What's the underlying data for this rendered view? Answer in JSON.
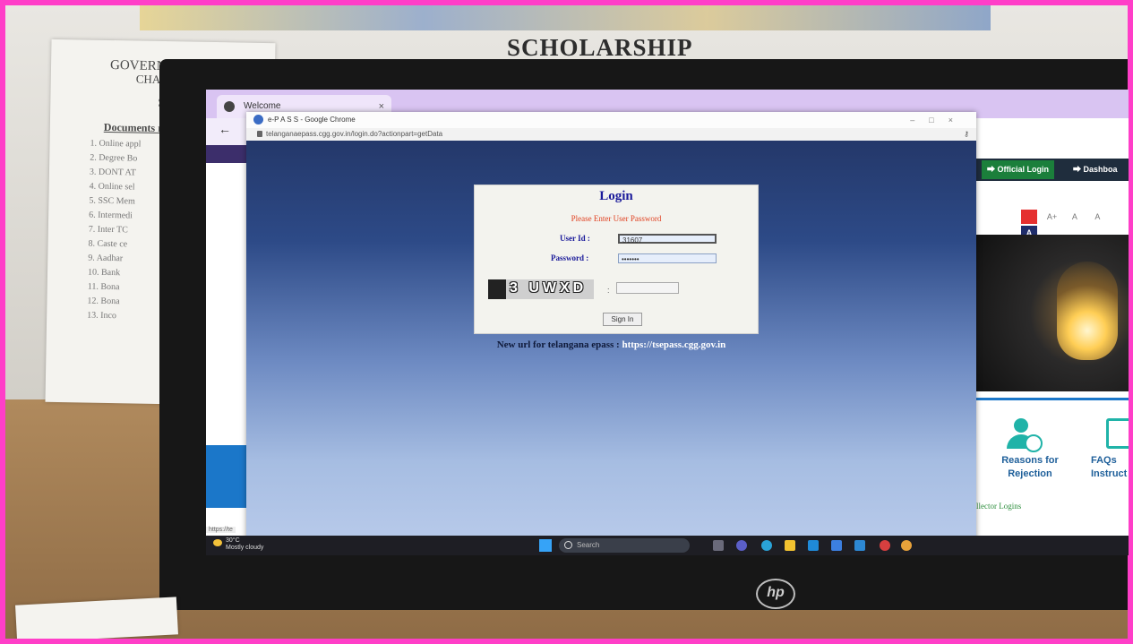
{
  "room": {
    "notice": {
      "heading_line1": "GOVERNM",
      "heading_line2": "CHANC",
      "heading_line3": "SC",
      "documents_label": "Documents r",
      "items": [
        "1. Online appl",
        "2. Degree Bo",
        "3. DONT AT",
        "4. Online sel",
        "5. SSC Mem",
        "6. Intermedi",
        "7. Inter TC",
        "8. Caste ce",
        "9. Aadhar",
        "10. Bank",
        "11. Bona",
        "12. Bona",
        "13. Inco"
      ]
    },
    "banner": "SCHOLARSHIP",
    "monitor_brand": "hp"
  },
  "browser": {
    "tab_title": "Welcome",
    "popup": {
      "window_title": "e-P A S S - Google Chrome",
      "url": "telanganaepass.cgg.gov.in/login.do?actionpart=getData",
      "login": {
        "title": "Login",
        "message": "Please Enter User Password",
        "user_id_label": "User Id  :",
        "user_id_value": "31607",
        "password_label": "Password  :",
        "password_value": "•••••••",
        "captcha_text": "3 UWXD",
        "captcha_separator": ":",
        "signin_label": "Sign In"
      },
      "new_url_text": "New url for telangana epass :",
      "new_url_link": "https://tsepass.cgg.gov.in"
    },
    "site": {
      "official_login": "Official Login",
      "dashboard": "Dashboa",
      "font_controls": [
        "A",
        "A+",
        "A",
        "A",
        "A"
      ],
      "reasons_label": "Reasons for Rejection",
      "faqs_label": "FAQs Instruct",
      "collector_login": "llector Logins"
    },
    "status_url": "https://te"
  },
  "taskbar": {
    "temperature": "30°C",
    "weather": "Mostly cloudy",
    "search_placeholder": "Search"
  }
}
